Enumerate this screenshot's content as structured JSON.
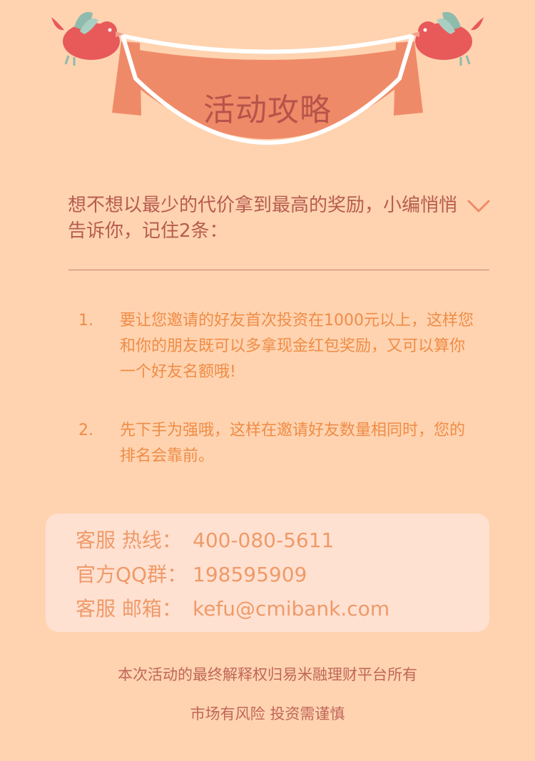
{
  "banner": {
    "title": "活动攻略",
    "colors": {
      "ribbon": "#ef8a68",
      "rope": "#ffffff",
      "bird": "#e8595a",
      "wing": "#8ebbac"
    }
  },
  "intro": {
    "text": "想不想以最少的代价拿到最高的奖励，小编悄悄告诉你，记住2条：",
    "toggle_icon": "chevron-down-icon"
  },
  "tips": [
    {
      "number": "1.",
      "text": "要让您邀请的好友首次投资在1000元以上，这样您和你的朋友既可以多拿现金红包奖励，又可以算你一个好友名额哦!"
    },
    {
      "number": "2.",
      "text": "先下手为强哦，这样在邀请好友数量相同时，您的排名会靠前。"
    }
  ],
  "contact": {
    "hotline_label": "客服 热线：",
    "hotline_value": "400-080-5611",
    "qq_label": "官方QQ群：",
    "qq_value": "198595909",
    "email_label": "客服 邮箱：",
    "email_value": "kefu@cmibank.com"
  },
  "footer": {
    "rights": "本次活动的最终解释权归易米融理财平台所有",
    "risk": "市场有风险 投资需谨慎"
  }
}
